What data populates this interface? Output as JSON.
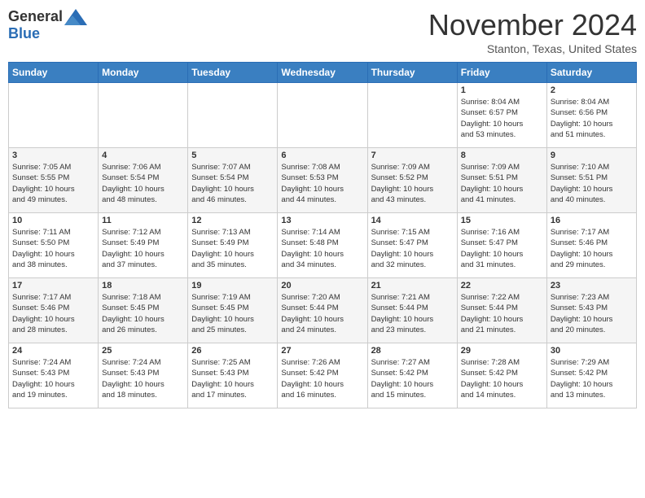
{
  "header": {
    "logo_general": "General",
    "logo_blue": "Blue",
    "month": "November 2024",
    "location": "Stanton, Texas, United States"
  },
  "weekdays": [
    "Sunday",
    "Monday",
    "Tuesday",
    "Wednesday",
    "Thursday",
    "Friday",
    "Saturday"
  ],
  "weeks": [
    [
      {
        "day": "",
        "info": ""
      },
      {
        "day": "",
        "info": ""
      },
      {
        "day": "",
        "info": ""
      },
      {
        "day": "",
        "info": ""
      },
      {
        "day": "",
        "info": ""
      },
      {
        "day": "1",
        "info": "Sunrise: 8:04 AM\nSunset: 6:57 PM\nDaylight: 10 hours\nand 53 minutes."
      },
      {
        "day": "2",
        "info": "Sunrise: 8:04 AM\nSunset: 6:56 PM\nDaylight: 10 hours\nand 51 minutes."
      }
    ],
    [
      {
        "day": "3",
        "info": "Sunrise: 7:05 AM\nSunset: 5:55 PM\nDaylight: 10 hours\nand 49 minutes."
      },
      {
        "day": "4",
        "info": "Sunrise: 7:06 AM\nSunset: 5:54 PM\nDaylight: 10 hours\nand 48 minutes."
      },
      {
        "day": "5",
        "info": "Sunrise: 7:07 AM\nSunset: 5:54 PM\nDaylight: 10 hours\nand 46 minutes."
      },
      {
        "day": "6",
        "info": "Sunrise: 7:08 AM\nSunset: 5:53 PM\nDaylight: 10 hours\nand 44 minutes."
      },
      {
        "day": "7",
        "info": "Sunrise: 7:09 AM\nSunset: 5:52 PM\nDaylight: 10 hours\nand 43 minutes."
      },
      {
        "day": "8",
        "info": "Sunrise: 7:09 AM\nSunset: 5:51 PM\nDaylight: 10 hours\nand 41 minutes."
      },
      {
        "day": "9",
        "info": "Sunrise: 7:10 AM\nSunset: 5:51 PM\nDaylight: 10 hours\nand 40 minutes."
      }
    ],
    [
      {
        "day": "10",
        "info": "Sunrise: 7:11 AM\nSunset: 5:50 PM\nDaylight: 10 hours\nand 38 minutes."
      },
      {
        "day": "11",
        "info": "Sunrise: 7:12 AM\nSunset: 5:49 PM\nDaylight: 10 hours\nand 37 minutes."
      },
      {
        "day": "12",
        "info": "Sunrise: 7:13 AM\nSunset: 5:49 PM\nDaylight: 10 hours\nand 35 minutes."
      },
      {
        "day": "13",
        "info": "Sunrise: 7:14 AM\nSunset: 5:48 PM\nDaylight: 10 hours\nand 34 minutes."
      },
      {
        "day": "14",
        "info": "Sunrise: 7:15 AM\nSunset: 5:47 PM\nDaylight: 10 hours\nand 32 minutes."
      },
      {
        "day": "15",
        "info": "Sunrise: 7:16 AM\nSunset: 5:47 PM\nDaylight: 10 hours\nand 31 minutes."
      },
      {
        "day": "16",
        "info": "Sunrise: 7:17 AM\nSunset: 5:46 PM\nDaylight: 10 hours\nand 29 minutes."
      }
    ],
    [
      {
        "day": "17",
        "info": "Sunrise: 7:17 AM\nSunset: 5:46 PM\nDaylight: 10 hours\nand 28 minutes."
      },
      {
        "day": "18",
        "info": "Sunrise: 7:18 AM\nSunset: 5:45 PM\nDaylight: 10 hours\nand 26 minutes."
      },
      {
        "day": "19",
        "info": "Sunrise: 7:19 AM\nSunset: 5:45 PM\nDaylight: 10 hours\nand 25 minutes."
      },
      {
        "day": "20",
        "info": "Sunrise: 7:20 AM\nSunset: 5:44 PM\nDaylight: 10 hours\nand 24 minutes."
      },
      {
        "day": "21",
        "info": "Sunrise: 7:21 AM\nSunset: 5:44 PM\nDaylight: 10 hours\nand 23 minutes."
      },
      {
        "day": "22",
        "info": "Sunrise: 7:22 AM\nSunset: 5:44 PM\nDaylight: 10 hours\nand 21 minutes."
      },
      {
        "day": "23",
        "info": "Sunrise: 7:23 AM\nSunset: 5:43 PM\nDaylight: 10 hours\nand 20 minutes."
      }
    ],
    [
      {
        "day": "24",
        "info": "Sunrise: 7:24 AM\nSunset: 5:43 PM\nDaylight: 10 hours\nand 19 minutes."
      },
      {
        "day": "25",
        "info": "Sunrise: 7:24 AM\nSunset: 5:43 PM\nDaylight: 10 hours\nand 18 minutes."
      },
      {
        "day": "26",
        "info": "Sunrise: 7:25 AM\nSunset: 5:43 PM\nDaylight: 10 hours\nand 17 minutes."
      },
      {
        "day": "27",
        "info": "Sunrise: 7:26 AM\nSunset: 5:42 PM\nDaylight: 10 hours\nand 16 minutes."
      },
      {
        "day": "28",
        "info": "Sunrise: 7:27 AM\nSunset: 5:42 PM\nDaylight: 10 hours\nand 15 minutes."
      },
      {
        "day": "29",
        "info": "Sunrise: 7:28 AM\nSunset: 5:42 PM\nDaylight: 10 hours\nand 14 minutes."
      },
      {
        "day": "30",
        "info": "Sunrise: 7:29 AM\nSunset: 5:42 PM\nDaylight: 10 hours\nand 13 minutes."
      }
    ]
  ]
}
